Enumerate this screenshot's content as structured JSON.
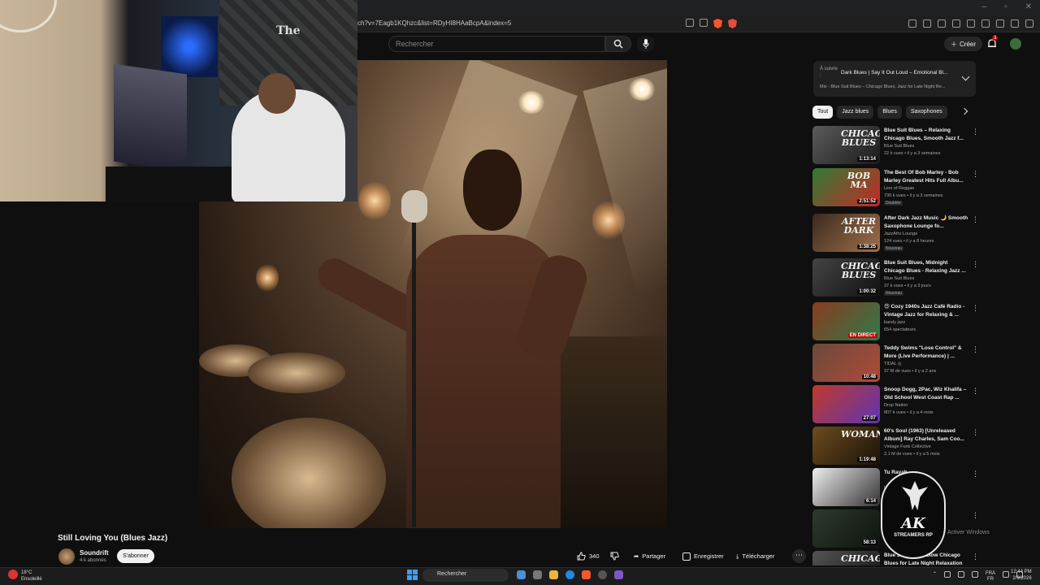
{
  "browser": {
    "url": "ch?v=7Eagb1KQhzc&list=RDyHI8HAaBcpA&index=5",
    "brave_badge": "2"
  },
  "header": {
    "search_placeholder": "Rechercher",
    "create_label": "Créer",
    "notifications_count": "3"
  },
  "webcam": {
    "wall_text": "The"
  },
  "video": {
    "title": "Still Loving You (Blues Jazz)",
    "channel": "Soundrift",
    "subscribers": "4 k abonnés",
    "subscribe_label": "S'abonner",
    "likes": "340",
    "share_label": "Partager",
    "save_label": "Enregistrer",
    "download_label": "Télécharger"
  },
  "playlist": {
    "next_label": "À suivre :",
    "next_title": "Dark Blues | Say It Out Loud – Emotional Bl...",
    "subtitle": "Mix - Blue Suit Blues – Chicago Blues, Jazz for Late Night Re..."
  },
  "chips": [
    "Tout",
    "Jazz blues",
    "Blues",
    "Saxophones"
  ],
  "recommendations": [
    {
      "title": "Blue Suit Blues – Relaxing Chicago Blues, Smooth Jazz f...",
      "channel": "Blue Suit Blues",
      "meta": "22 k vues • il y a 3 semaines",
      "duration": "1:13:14",
      "badge": "",
      "colors": [
        "#5b5b5b",
        "#1a1a1a"
      ],
      "thumb_text": "CHICAGO BLUES"
    },
    {
      "title": "The Best Of Bob Marley - Bob Marley Greatest Hits Full Albu...",
      "channel": "Lion of Reggae",
      "meta": "730 k vues • il y a 3 semaines",
      "duration": "2:51:52",
      "badge": "Doublée",
      "colors": [
        "#2e7d32",
        "#c62828"
      ],
      "thumb_text": "BOB MA"
    },
    {
      "title": "After Dark Jazz Music 🌙 Smooth Saxophone Lounge fo...",
      "channel": "JazzAfro Lounge",
      "meta": "124 vues • il y a 8 heures",
      "duration": "1:38:25",
      "badge": "Nouveau",
      "colors": [
        "#3b2a20",
        "#a0704a"
      ],
      "thumb_text": "AFTER DARK"
    },
    {
      "title": "Blue Suit Blues, Midnight Chicago Blues - Relaxing Jazz ...",
      "channel": "Blue Suit Blues",
      "meta": "37 k vues • il y a 3 jours",
      "duration": "1:00:32",
      "badge": "Nouveau",
      "colors": [
        "#444",
        "#111"
      ],
      "thumb_text": "CHICAGO BLUES"
    },
    {
      "title": "😍 Cozy 1940s Jazz Café Radio - Vintage Jazz for Relaxing & ...",
      "channel": "barely jazz",
      "meta": "654 spectateurs",
      "duration": "",
      "live": "EN DIRECT",
      "badge": "",
      "colors": [
        "#8a3b1e",
        "#2e7a4a"
      ],
      "thumb_text": ""
    },
    {
      "title": "Teddy Swims \"Lose Control\" & More (Live Performance) | ...",
      "channel": "TIDAL ◎",
      "meta": "37 M de vues • il y a 2 ans",
      "duration": "10:48",
      "badge": "",
      "colors": [
        "#6a4a3a",
        "#b04a3a"
      ],
      "thumb_text": ""
    },
    {
      "title": "Snoop Dogg, 2Pac, Wiz Khalifa – Old School West Coast Rap ...",
      "channel": "Drop Nation",
      "meta": "807 k vues • il y a 4 mois",
      "duration": "27:07",
      "badge": "",
      "colors": [
        "#c0392b",
        "#5e35b1"
      ],
      "thumb_text": ""
    },
    {
      "title": "60's Soul (1963) [Unreleased Album] Ray Charles, Sam Coo...",
      "channel": "Vintage Funk Collective",
      "meta": "2,1 M de vues • il y a 5 mois",
      "duration": "1:19:48",
      "badge": "",
      "colors": [
        "#6d4c1e",
        "#1a1208"
      ],
      "thumb_text": "WOMAN"
    },
    {
      "title": "Tu Rayah...",
      "channel": "Ra...",
      "meta": "",
      "duration": "6:14",
      "badge": "",
      "colors": [
        "#eeeeee",
        "#333333"
      ],
      "thumb_text": ""
    },
    {
      "title": "Silent |",
      "channel": "",
      "meta": "",
      "duration": "58:13",
      "badge": "",
      "colors": [
        "#2e3b2e",
        "#0e120e"
      ],
      "thumb_text": ""
    },
    {
      "title": "Blue Suit Blues, Slow Chicago Blues for Late Night Relaxation",
      "channel": "",
      "meta": "",
      "duration": "",
      "badge": "",
      "colors": [
        "#555",
        "#111"
      ],
      "thumb_text": "CHICAGO"
    }
  ],
  "overlay": {
    "logo_main": "AK",
    "logo_sub": "STREAMERS RP",
    "windows_activate": "Activer Windows"
  },
  "taskbar": {
    "temperature": "18°C",
    "weather_desc": "Ensoleillé",
    "search_label": "Rechercher",
    "lang_top": "FRA",
    "lang_bottom": "FR",
    "time": "12:44 PM",
    "date": "2/9/2026"
  }
}
